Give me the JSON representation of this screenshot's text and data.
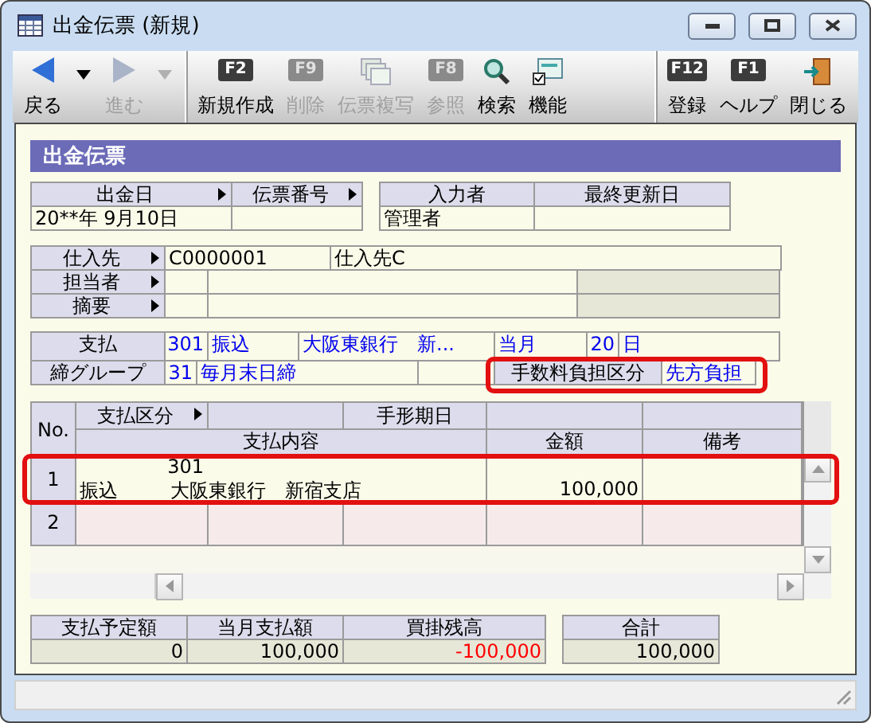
{
  "window": {
    "title": "出金伝票 (新規)"
  },
  "toolbar": {
    "groups": [
      [
        {
          "kind": "back",
          "label": "戻る",
          "disabled": false
        },
        {
          "kind": "dropdown",
          "disabled": false
        },
        {
          "kind": "forward",
          "label": "進む",
          "disabled": true
        },
        {
          "kind": "dropdown",
          "disabled": true
        }
      ],
      [
        {
          "kind": "fkey",
          "key": "F2",
          "label": "新規作成",
          "disabled": false
        },
        {
          "kind": "fkey",
          "key": "F9",
          "label": "削除",
          "disabled": true
        },
        {
          "kind": "copy",
          "label": "伝票複写",
          "disabled": true
        },
        {
          "kind": "fkey",
          "key": "F8",
          "label": "参照",
          "disabled": true
        },
        {
          "kind": "search",
          "label": "検索",
          "disabled": false
        },
        {
          "kind": "function",
          "label": "機能",
          "disabled": false
        }
      ],
      [
        {
          "kind": "fkey",
          "key": "F12",
          "label": "登録",
          "disabled": false
        },
        {
          "kind": "fkey",
          "key": "F1",
          "label": "ヘルプ",
          "disabled": false
        },
        {
          "kind": "exit",
          "label": "閉じる",
          "disabled": false
        }
      ]
    ]
  },
  "form": {
    "title": "出金伝票",
    "header": {
      "left": [
        {
          "label": "出金日",
          "lookup": true,
          "value": "20**年 9月10日"
        },
        {
          "label": "伝票番号",
          "lookup": true
        }
      ],
      "right": [
        {
          "label": "入力者",
          "lookup": false,
          "value": "管理者"
        },
        {
          "label": "最終更新日",
          "lookup": false
        }
      ]
    },
    "supplier": [
      {
        "label": "仕入先",
        "lookup": true,
        "code": "C0000001",
        "name": "仕入先C"
      },
      {
        "label": "担当者",
        "lookup": true
      },
      {
        "label": "摘要",
        "lookup": true
      }
    ],
    "payment": {
      "label": "支払",
      "code": "301",
      "method": "振込",
      "bank": "大阪東銀行　新...",
      "timing": "当月",
      "day": "20",
      "day_unit": "日"
    },
    "closing": {
      "label": "締グループ",
      "code": "31",
      "name": "毎月末日締"
    },
    "fee": {
      "label": "手数料負担区分",
      "value": "先方負担",
      "highlighted": true
    },
    "detail": {
      "no_header": "No.",
      "type_header": "支払区分",
      "type_lookup": true,
      "due_header": "手形期日",
      "content_header": "支払内容",
      "amount_header": "金額",
      "note_header": "備考",
      "rows": [
        {
          "no": "1",
          "kind": "filled",
          "code": "301",
          "type": "振込",
          "bank": "大阪東銀行　新宿支店",
          "amount": "100,000",
          "highlighted": true
        },
        {
          "no": "2",
          "kind": "new",
          "highlighted": false
        }
      ]
    },
    "totals": [
      [
        {
          "label": "支払予定額",
          "value": "0",
          "negative": false
        },
        {
          "label": "当月支払額",
          "value": "100,000",
          "negative": false
        },
        {
          "label": "買掛残高",
          "value": "-100,000",
          "negative": true
        }
      ],
      [
        {
          "label": "合計",
          "value": "100,000",
          "negative": false
        }
      ]
    ]
  }
}
